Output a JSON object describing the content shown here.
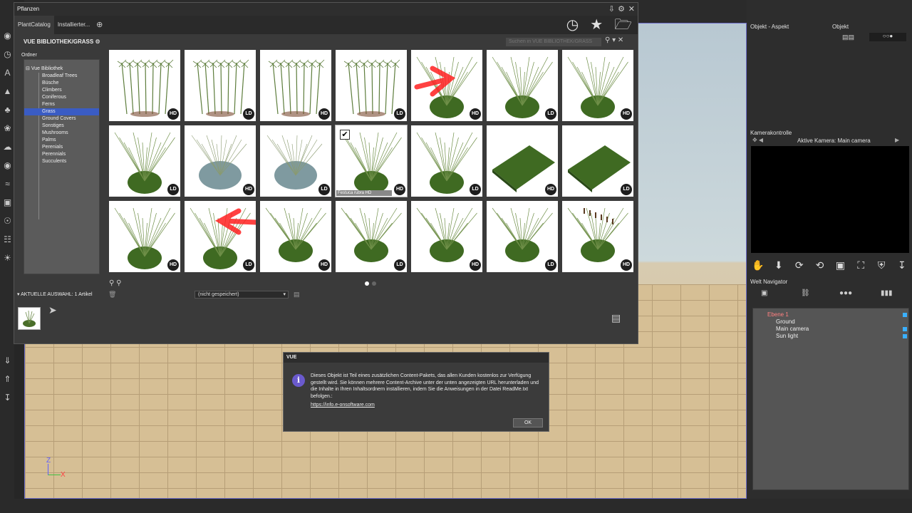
{
  "window": {
    "title": "Pflanzen",
    "tabs": [
      "PlantCatalog",
      "Installierter..."
    ]
  },
  "library": {
    "title": "VUE BIBLIOTHEK/GRASS",
    "search_placeholder": "Suchen in VUE BIBLIOTHEK/GRASS",
    "folders_label": "Ordner",
    "root": "Vue Bibliothek",
    "folders": [
      "Broadleaf Trees",
      "Büsche",
      "Climbers",
      "Coniferous",
      "Ferns",
      "Grass",
      "Ground Covers",
      "Sonstiges",
      "Mushrooms",
      "Palms",
      "Perenials",
      "Perennials",
      "Succulents"
    ],
    "selected_folder": "Grass"
  },
  "thumbnails": [
    {
      "badge": "HD",
      "kind": "papyrus"
    },
    {
      "badge": "LD",
      "kind": "papyrus"
    },
    {
      "badge": "HD",
      "kind": "papyrus"
    },
    {
      "badge": "LD",
      "kind": "papyrus"
    },
    {
      "badge": "HD",
      "kind": "tuft-red-arrow"
    },
    {
      "badge": "LD",
      "kind": "tuft"
    },
    {
      "badge": "HD",
      "kind": "tuft"
    },
    {
      "badge": "LD",
      "kind": "tuft"
    },
    {
      "badge": "HD",
      "kind": "blue-tuft"
    },
    {
      "badge": "LD",
      "kind": "blue-tuft"
    },
    {
      "badge": "HD",
      "kind": "tuft",
      "caption": "Festuca rubra HD",
      "checked": true
    },
    {
      "badge": "LD",
      "kind": "tuft"
    },
    {
      "badge": "HD",
      "kind": "turf"
    },
    {
      "badge": "LD",
      "kind": "turf"
    },
    {
      "badge": "HD",
      "kind": "wild"
    },
    {
      "badge": "LD",
      "kind": "wild-red-arrow"
    },
    {
      "badge": "HD",
      "kind": "reeds"
    },
    {
      "badge": "LD",
      "kind": "reeds"
    },
    {
      "badge": "HD",
      "kind": "tall"
    },
    {
      "badge": "LD",
      "kind": "tall"
    },
    {
      "badge": "HD",
      "kind": "cattail"
    }
  ],
  "selection": {
    "label": "AKTUELLE AUSWAHL: 1 Artikel",
    "dropdown_value": "(nicht gespeichert)"
  },
  "pagination": {
    "current": 1,
    "total": 2
  },
  "dialog": {
    "title": "VUE",
    "message": "Dieses Objekt ist Teil eines zusätzlichen Content-Pakets, das allen Kunden kostenlos zur Verfügung gestellt wird. Sie können mehrere Content-Archive unter der unten angezeigten URL herunterladen und die Inhalte in Ihren Inhaltsordnern installieren, indem Sie die Anweisungen in der Datei ReadMe.txt befolgen.:",
    "link": "https://info.e-onsoftware.com",
    "ok": "OK"
  },
  "right_panel": {
    "aspect_header": "Objekt - Aspekt",
    "object_header": "Objekt",
    "camera_header": "Kamerakontrolle",
    "active_camera": "Aktive Kamera: Main camera",
    "navigator_header": "Welt Navigator",
    "tree": {
      "layer": "Ebene 1",
      "items": [
        "Ground",
        "Main camera",
        "Sun light"
      ]
    }
  },
  "viewport": {
    "axis_z": "Z",
    "axis_x": "X"
  },
  "colors": {
    "accent": "#3a5cc4",
    "viewport_border": "#6c6cc8",
    "dialog_icon": "#6a5acd"
  }
}
